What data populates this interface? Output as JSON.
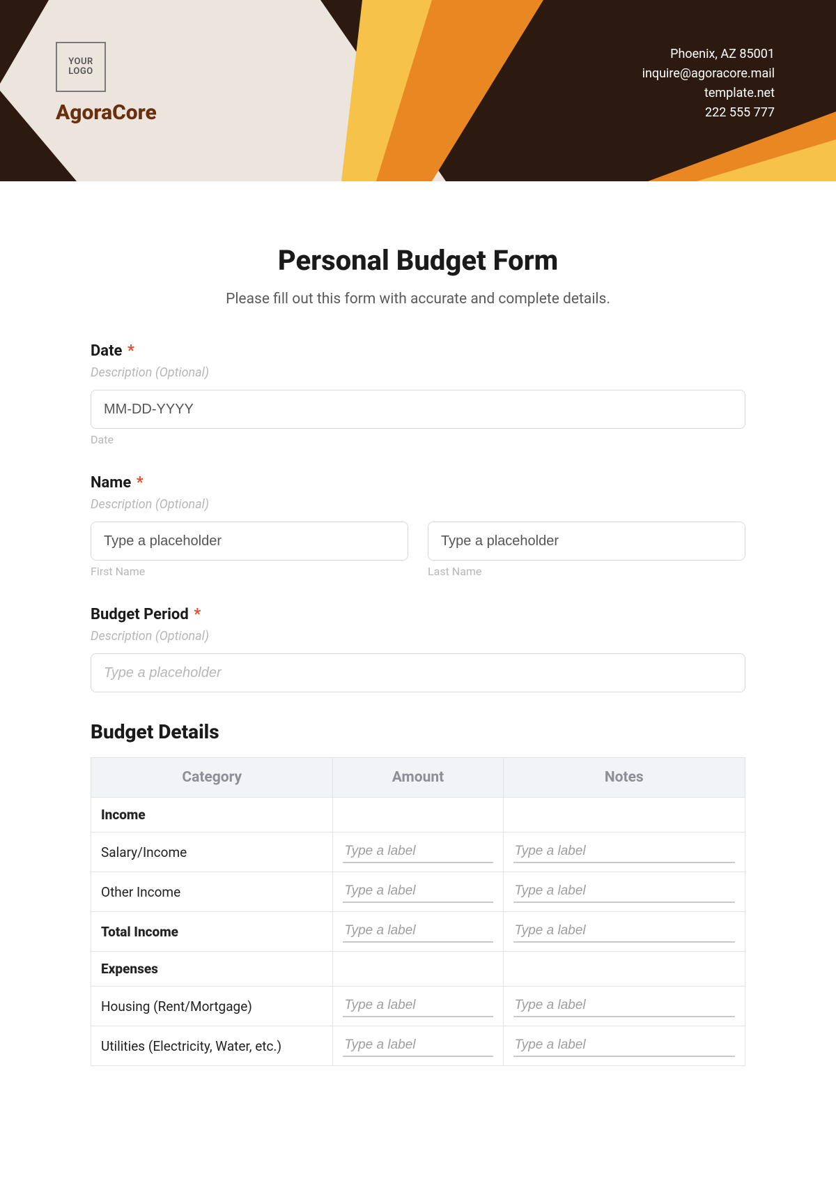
{
  "header": {
    "logo_text": "YOUR LOGO",
    "brand": "AgoraCore",
    "contact": {
      "line1": "Phoenix, AZ 85001",
      "line2": "inquire@agoracore.mail",
      "line3": "template.net",
      "line4": "222 555 777"
    }
  },
  "form": {
    "title": "Personal Budget Form",
    "subtitle": "Please fill out this form with accurate and complete details.",
    "required_marker": "*",
    "desc_placeholder": "Description (Optional)",
    "cell_placeholder": "Type a label",
    "short_placeholder": "Type a placeholder",
    "date": {
      "label": "Date",
      "placeholder": "MM-DD-YYYY",
      "sublabel": "Date"
    },
    "name": {
      "label": "Name",
      "first_sub": "First Name",
      "last_sub": "Last Name"
    },
    "period": {
      "label": "Budget Period"
    },
    "details": {
      "heading": "Budget Details",
      "columns": [
        "Category",
        "Amount",
        "Notes"
      ],
      "rows": [
        {
          "label": "Income",
          "bold": true,
          "inputs": false
        },
        {
          "label": "Salary/Income",
          "bold": false,
          "inputs": true
        },
        {
          "label": "Other Income",
          "bold": false,
          "inputs": true
        },
        {
          "label": "Total Income",
          "bold": true,
          "inputs": true
        },
        {
          "label": "Expenses",
          "bold": true,
          "inputs": false
        },
        {
          "label": "Housing (Rent/Mortgage)",
          "bold": false,
          "inputs": true
        },
        {
          "label": "Utilities (Electricity, Water, etc.)",
          "bold": false,
          "inputs": true
        }
      ]
    }
  }
}
